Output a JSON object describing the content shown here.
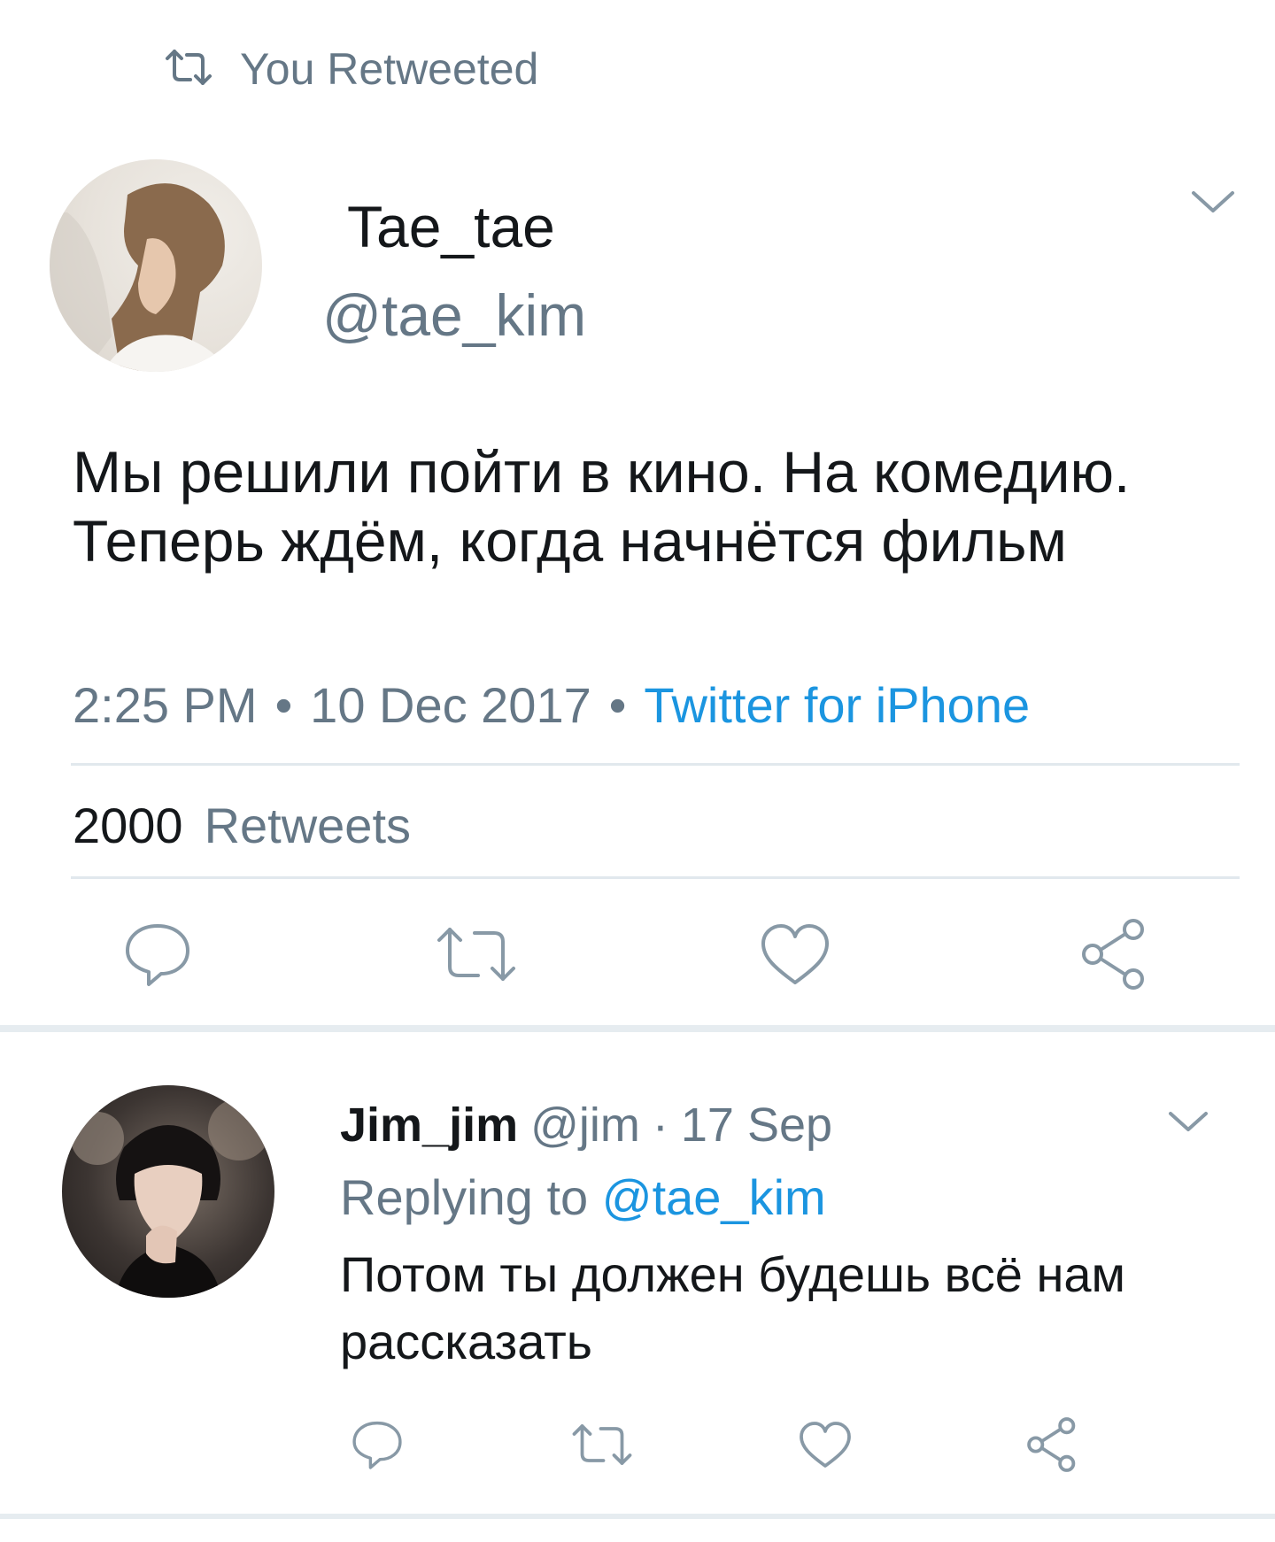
{
  "retweet_header": {
    "label": "You Retweeted"
  },
  "tweet": {
    "author_name": "Tae_tae",
    "author_handle": "@tae_kim",
    "text_line1": "Мы решили пойти в кино. На комедию.",
    "text_line2": "Теперь ждём, когда начнётся фильм",
    "time": "2:25 PM",
    "date": "10 Dec 2017",
    "source": "Twitter for iPhone",
    "separator": "•",
    "retweets_count": "2000",
    "retweets_label": "Retweets"
  },
  "reply": {
    "author_name": "Jim_jim",
    "author_handle": "@jim",
    "separator": "·",
    "date": "17 Sep",
    "replying_prefix": "Replying to",
    "replying_handle": "@tae_kim",
    "text": "Потом ты должен будешь всё нам рассказать"
  },
  "colors": {
    "text": "#14171a",
    "muted": "#657786",
    "accent": "#1b95e0",
    "divider": "#e1e8ed"
  },
  "icons": {
    "header": "retweet-icon",
    "menu": "chevron-down-icon",
    "actions": [
      "reply-icon",
      "retweet-icon",
      "like-icon",
      "share-icon"
    ]
  }
}
